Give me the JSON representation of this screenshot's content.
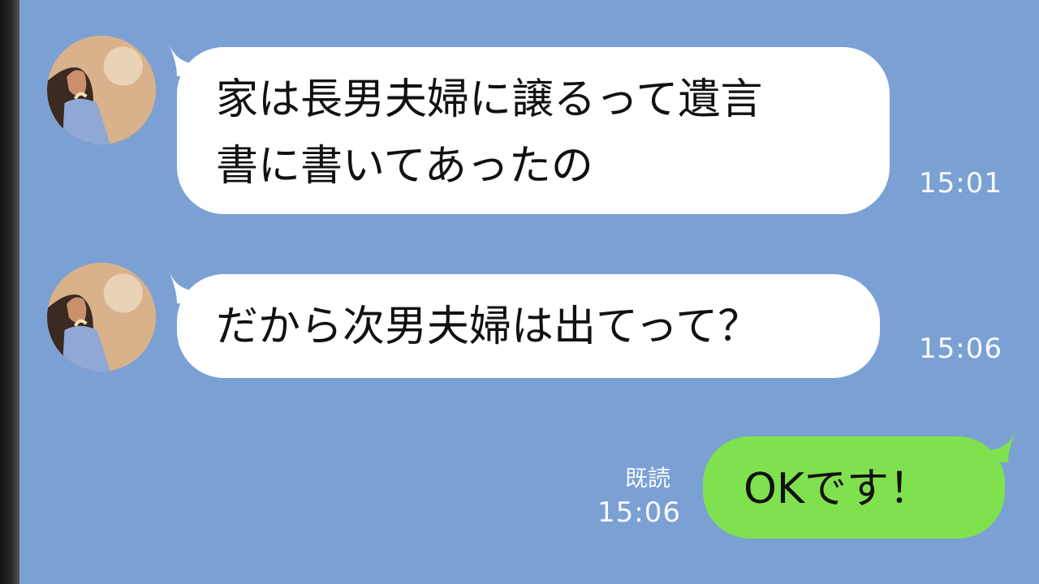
{
  "chat": {
    "messages": [
      {
        "direction": "incoming",
        "text": "家は長男夫婦に譲るって遺言\n書に書いてあったの",
        "time": "15:01"
      },
      {
        "direction": "incoming",
        "text": "だから次男夫婦は出てって？",
        "time": "15:06"
      },
      {
        "direction": "outgoing",
        "text": "OKです！",
        "read_label": "既読",
        "time": "15:06"
      }
    ]
  },
  "colors": {
    "background": "#7ba1d4",
    "incoming_bubble": "#ffffff",
    "outgoing_bubble": "#7fe14e",
    "meta_text": "#ffffff"
  },
  "icons": {
    "avatar": "avatar-photo",
    "incoming_tail": "bubble-tail-icon",
    "outgoing_tail": "bubble-tail-icon"
  }
}
